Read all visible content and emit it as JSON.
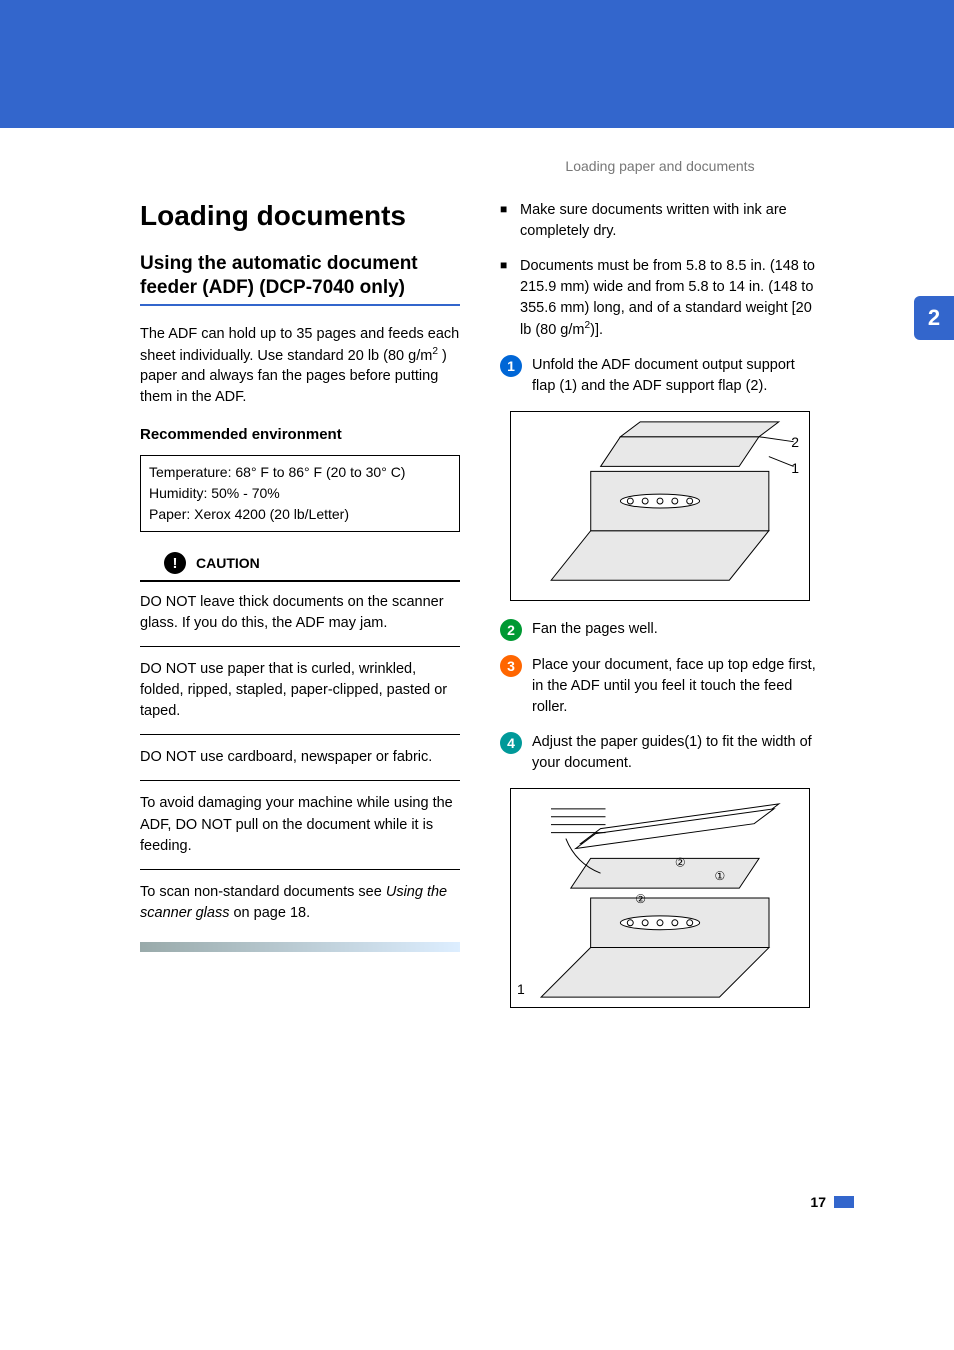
{
  "header": {
    "running_head": "Loading paper and documents",
    "chapter_tab": "2",
    "page_number": "17"
  },
  "left": {
    "h1": "Loading documents",
    "h2": "Using the automatic document feeder (ADF) (DCP-7040 only)",
    "intro_a": "The ADF can hold up to 35 pages and feeds each sheet individually. Use standard 20 lb (80 g/m",
    "intro_b": " ) paper and always fan the pages before putting them in the ADF.",
    "h3": "Recommended environment",
    "env": {
      "line1": "Temperature: 68° F to 86° F (20 to 30° C)",
      "line2": "Humidity: 50% - 70%",
      "line3": "Paper: Xerox 4200 (20 lb/Letter)"
    },
    "caution_label": "CAUTION",
    "cautions": [
      "DO NOT leave thick documents on the scanner glass. If you do this, the ADF may jam.",
      "DO NOT use paper that is curled, wrinkled, folded, ripped, stapled, paper-clipped, pasted or taped.",
      "DO NOT use cardboard, newspaper or fabric.",
      "To avoid damaging your machine while using the ADF, DO NOT pull on the document while it is feeding."
    ],
    "caution_ref_a": "To scan non-standard documents see ",
    "caution_ref_link": "Using the scanner glass",
    "caution_ref_b": " on page 18."
  },
  "right": {
    "bullets": [
      "Make sure documents written with ink are completely dry."
    ],
    "bullet2_a": "Documents must be from 5.8 to 8.5 in. (148 to 215.9 mm) wide and from 5.8 to 14 in. (148 to 355.6 mm) long, and of a standard weight [20 lb (80 g/m",
    "bullet2_b": ")].",
    "steps": {
      "s1": "Unfold the ADF document output support flap (1) and the ADF support flap (2).",
      "s2": "Fan the pages well.",
      "s3": "Place your document, face up top edge first, in the ADF until you feel it touch the feed roller.",
      "s4": "Adjust the paper guides(1) to fit the width of your document."
    },
    "fig1": {
      "label1": "1",
      "label2": "2"
    },
    "fig2": {
      "label1": "1",
      "marker1": "①",
      "marker2": "②"
    }
  }
}
